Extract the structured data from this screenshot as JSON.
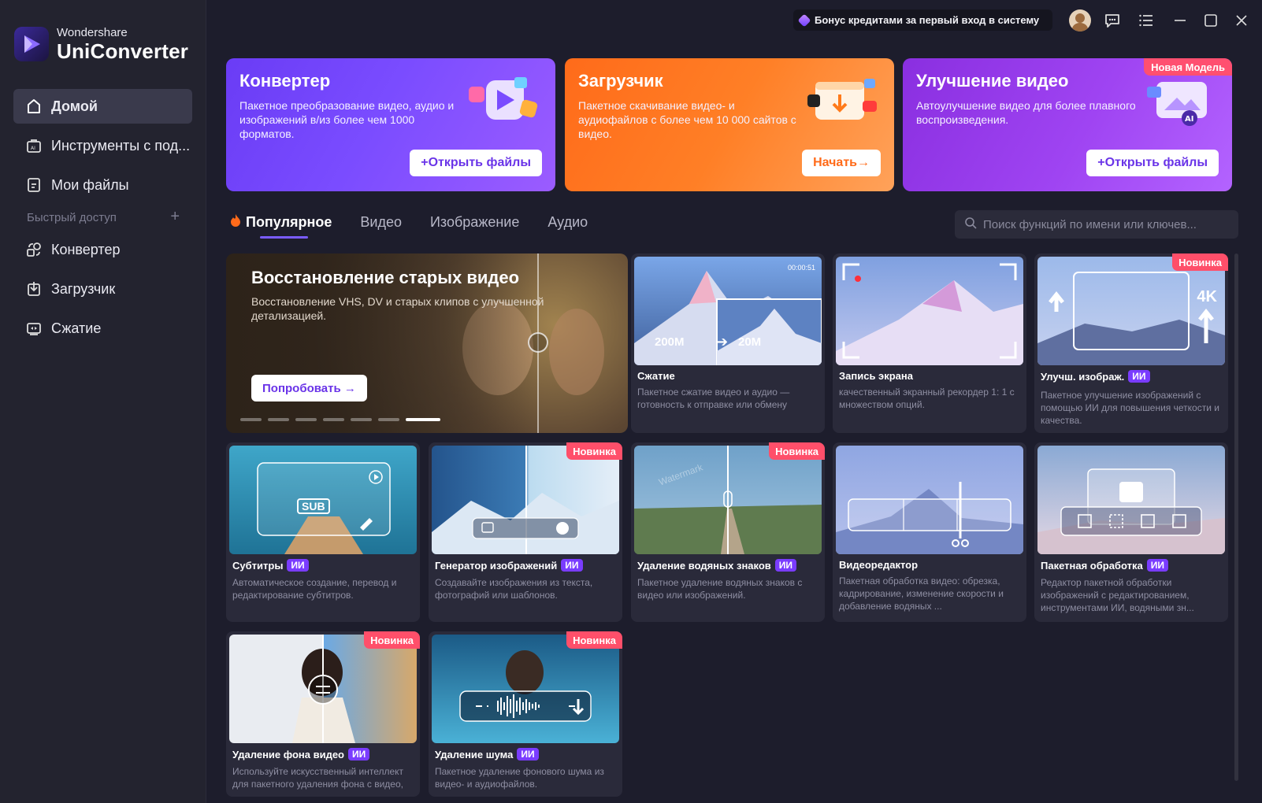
{
  "app": {
    "brand_sub": "Wondershare",
    "brand_main": "UniConverter"
  },
  "sidebar": {
    "nav": [
      {
        "label": "Домой",
        "icon": "home-icon"
      },
      {
        "label": "Инструменты с под...",
        "icon": "toolbox-icon"
      },
      {
        "label": "Мои файлы",
        "icon": "file-icon"
      }
    ],
    "quick_access_label": "Быстрый доступ",
    "quick": [
      {
        "label": "Конвертер",
        "icon": "converter-icon"
      },
      {
        "label": "Загрузчик",
        "icon": "download-icon"
      },
      {
        "label": "Сжатие",
        "icon": "compress-icon"
      }
    ]
  },
  "titlebar": {
    "bonus": "Бонус кредитами за первый вход в систему"
  },
  "banners": [
    {
      "title": "Конвертер",
      "desc": "Пакетное преобразование видео, аудио и изображений в/из более чем 1000 форматов.",
      "button": "+Открыть файлы"
    },
    {
      "title": "Загрузчик",
      "desc": "Пакетное скачивание видео- и аудиофайлов с более чем 10 000 сайтов с видео.",
      "button": "Начать→"
    },
    {
      "title": "Улучшение видео",
      "desc": "Автоулучшение видео для более плавного воспроизведения.",
      "button": "+Открыть файлы",
      "badge": "Новая Модель"
    }
  ],
  "tabs": [
    "Популярное",
    "Видео",
    "Изображение",
    "Аудио"
  ],
  "search": {
    "placeholder": "Поиск функций по имени или ключев..."
  },
  "hero": {
    "title": "Восстановление старых видео",
    "desc": "Восстановление VHS, DV и старых клипов с улучшенной детализацией.",
    "button": "Попробовать →"
  },
  "tools": [
    {
      "title": "Сжатие",
      "ai": "",
      "desc": "Пакетное сжатие видео и аудио — готовность к отправке или обмену",
      "badge": "",
      "size_from": "200M",
      "size_to": "20M",
      "time": "00:00:51"
    },
    {
      "title": "Запись экрана",
      "ai": "",
      "desc": "качественный экранный рекордер 1: 1 с множеством опций.",
      "badge": ""
    },
    {
      "title": "Улучш. изображ.",
      "ai": "ИИ",
      "desc": "Пакетное улучшение изображений с помощью ИИ для повышения четкости и качества.",
      "badge": "Новинка",
      "res": "4K"
    },
    {
      "title": "Субтитры",
      "ai": "ИИ",
      "desc": "Автоматическое создание, перевод и редактирование субтитров.",
      "badge": "",
      "sub_label": "SUB"
    },
    {
      "title": "Генератор изображений",
      "ai": "ИИ",
      "desc": "Создавайте изображения из текста, фотографий или шаблонов.",
      "badge": "Новинка"
    },
    {
      "title": "Удаление водяных знаков",
      "ai": "ИИ",
      "desc": "Пакетное удаление водяных знаков с видео или изображений.",
      "badge": "Новинка",
      "watermark": "Watermark"
    },
    {
      "title": "Видеоредактор",
      "ai": "",
      "desc": "Пакетная обработка видео: обрезка, кадрирование, изменение скорости и добавление водяных ...",
      "badge": ""
    },
    {
      "title": "Пакетная обработка",
      "ai": "ИИ",
      "desc": "Редактор пакетной обработки изображений с редактированием, инструментами ИИ, водяными зн...",
      "badge": ""
    },
    {
      "title": "Удаление фона видео",
      "ai": "ИИ",
      "desc": "Используйте искусственный интеллект для пакетного удаления фона с видео, вне зависимости...",
      "badge": "Новинка"
    },
    {
      "title": "Удаление шума",
      "ai": "ИИ",
      "desc": "Пакетное удаление фонового шума из видео- и аудиофайлов.",
      "badge": "Новинка"
    }
  ]
}
